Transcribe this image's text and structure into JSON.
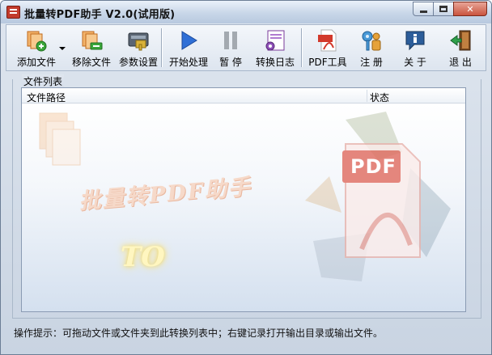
{
  "window": {
    "title": "批量转PDF助手 V2.0(试用版)"
  },
  "toolbar": {
    "items": [
      {
        "label": "添加文件",
        "icon": "add-file-icon"
      },
      {
        "label": "移除文件",
        "icon": "remove-file-icon"
      },
      {
        "label": "参数设置",
        "icon": "settings-icon"
      },
      {
        "label": "开始处理",
        "icon": "play-icon"
      },
      {
        "label": "暂  停",
        "icon": "pause-icon"
      },
      {
        "label": "转换日志",
        "icon": "log-icon"
      },
      {
        "label": "PDF工具",
        "icon": "pdf-tool-icon"
      },
      {
        "label": "注  册",
        "icon": "register-key-icon"
      },
      {
        "label": "关  于",
        "icon": "about-info-icon"
      },
      {
        "label": "退  出",
        "icon": "exit-door-icon"
      }
    ]
  },
  "file_list": {
    "group_label": "文件列表",
    "columns": [
      "文件路径",
      "状态"
    ],
    "watermark_title": "批量转PDF助手",
    "watermark_to": "TO",
    "watermark_pdf": "PDF"
  },
  "status_bar": {
    "hint": "操作提示：可拖动文件或文件夹到此转换列表中；右键记录打开输出目录或输出文件。"
  },
  "colors": {
    "accent_blue": "#2f6fd6",
    "pdf_red": "#d2392b"
  }
}
